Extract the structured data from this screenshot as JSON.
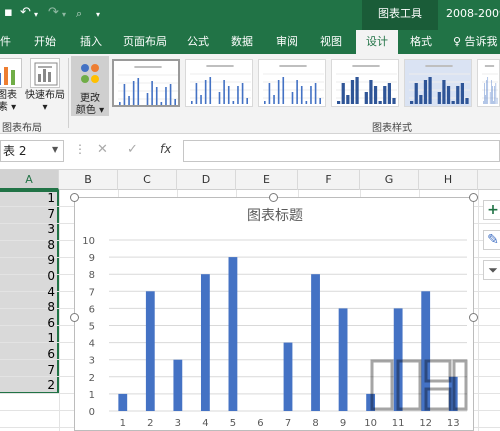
{
  "titlebar": {
    "context_tab": "图表工具",
    "doc_title": "2008-2009"
  },
  "tabs": [
    {
      "label": "件"
    },
    {
      "label": "开始"
    },
    {
      "label": "插入"
    },
    {
      "label": "页面布局"
    },
    {
      "label": "公式"
    },
    {
      "label": "数据"
    },
    {
      "label": "审阅"
    },
    {
      "label": "视图"
    },
    {
      "label": "设计"
    },
    {
      "label": "格式"
    },
    {
      "label": "♀ 告诉我"
    }
  ],
  "ribbon": {
    "add_element_label": "图表",
    "add_element_label2": "素 ▾",
    "quick_layout_label": "快速布局",
    "quick_layout_label2": "▾",
    "change_colors_label": "更改",
    "change_colors_label2": "颜色 ▾",
    "group_layout_label": "图表布局",
    "group_styles_label": "图表样式"
  },
  "formula_bar": {
    "name_box": "表 2",
    "fx": "fx"
  },
  "columns": [
    "A",
    "B",
    "C",
    "D",
    "E",
    "F",
    "G",
    "H"
  ],
  "sheet": {
    "column_a_values": [
      "1",
      "7",
      "3",
      "8",
      "9",
      "0",
      "4",
      "8",
      "6",
      "1",
      "6",
      "7",
      "2"
    ]
  },
  "chart_data": {
    "type": "bar",
    "title": "图表标题",
    "categories": [
      "1",
      "2",
      "3",
      "4",
      "5",
      "6",
      "7",
      "8",
      "9",
      "10",
      "11",
      "12",
      "13"
    ],
    "values": [
      1,
      7,
      3,
      8,
      9,
      0,
      4,
      8,
      6,
      1,
      6,
      7,
      2
    ],
    "ylim": [
      0,
      10
    ],
    "yticks": [
      "0",
      "1",
      "2",
      "3",
      "4",
      "5",
      "6",
      "7",
      "8",
      "9",
      "10"
    ],
    "grid": true,
    "bar_color": "#4472c4"
  },
  "colors": {
    "excel_green": "#217346",
    "accent_blue": "#4472c4"
  }
}
